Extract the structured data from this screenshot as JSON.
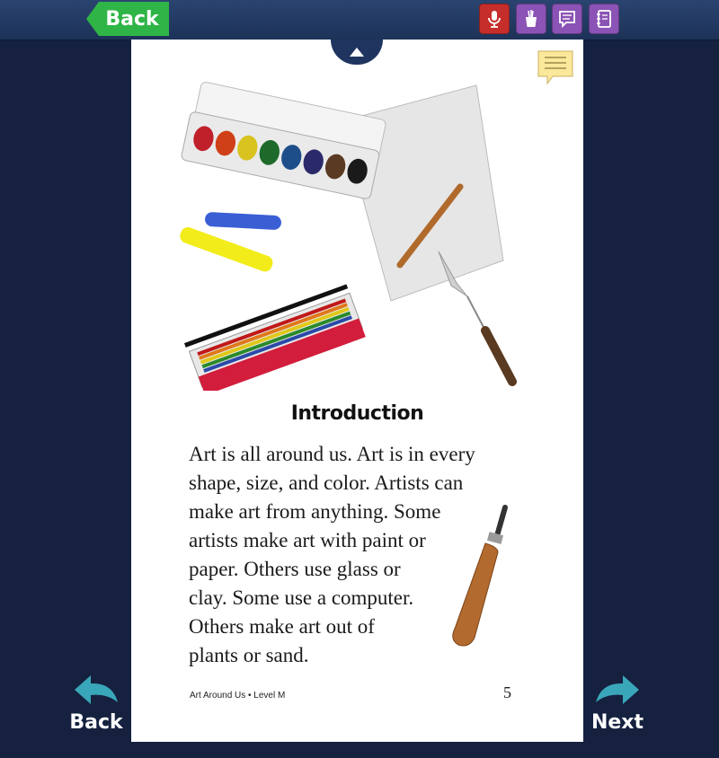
{
  "toolbar": {
    "back_label": "Back",
    "tools": [
      "microphone-icon",
      "cup-icon",
      "chat-icon",
      "notebook-icon"
    ]
  },
  "page": {
    "heading": "Introduction",
    "body_lines": [
      "Art is all around us. Art is in every",
      "shape, size, and color. Artists can",
      "make art from anything. Some",
      "artists make art with paint or",
      "paper. Others use glass or",
      "clay. Some use a computer.",
      "Others make art out of",
      "plants or sand."
    ],
    "footer": "Art Around Us • Level M",
    "page_number": "5"
  },
  "nav": {
    "back_label": "Back",
    "next_label": "Next"
  },
  "colors": {
    "background": "#15213f",
    "topbar": "#1d3258",
    "back_green": "#2fb547",
    "mic_red": "#c62e2b",
    "tool_purple": "#8b53b5",
    "arrow_teal": "#3aa6b9"
  }
}
